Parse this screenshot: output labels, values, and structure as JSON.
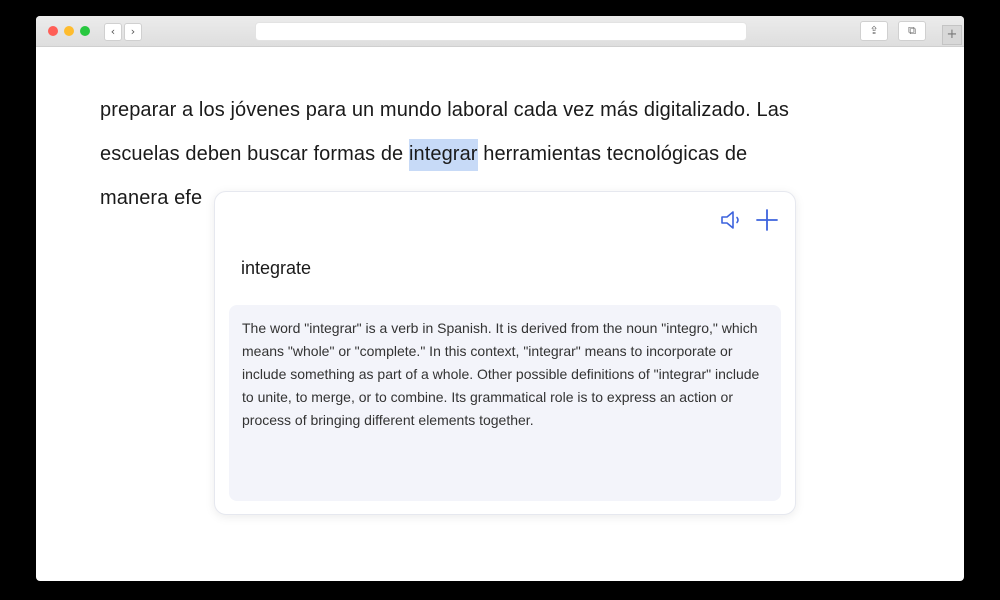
{
  "browser": {
    "back_label": "‹",
    "forward_label": "›",
    "share_label": "⇪",
    "tabs_label": "⧉",
    "newtab_label": "+"
  },
  "article": {
    "line1": "preparar a los jóvenes para un mundo laboral cada vez más digitalizado. Las",
    "line2_before": "escuelas deben buscar formas de ",
    "line2_highlight": "integrar",
    "line2_after": " herramientas tecnológicas de",
    "line3": "manera efe"
  },
  "popup": {
    "translation": "integrate",
    "definition": "The word \"integrar\" is a verb in Spanish. It is derived from the noun \"integro,\" which means \"whole\" or \"complete.\" In this context, \"integrar\" means to incorporate or include something as part of a whole. Other possible definitions of \"integrar\" include to unite, to merge, or to combine. Its grammatical role is to express an action or process of bringing different elements together.",
    "accent_color": "#3d63dd"
  },
  "icons": {
    "speaker": "speaker-icon",
    "add": "plus-icon"
  }
}
